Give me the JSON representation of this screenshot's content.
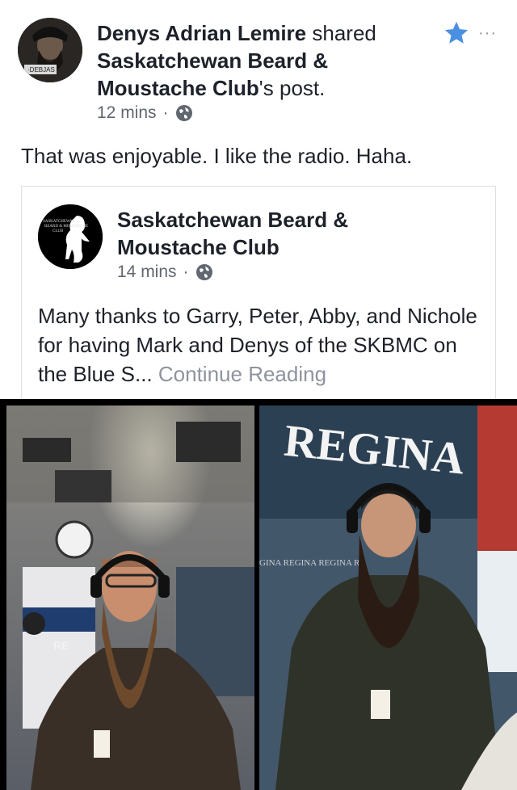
{
  "post": {
    "author": "Denys Adrian Lemire",
    "action": "shared",
    "shared_page": "Saskatchewan Beard & Moustache Club",
    "shared_suffix": "'s post.",
    "time": "12 mins",
    "separator": "·",
    "text": "That was enjoyable. I like the radio. Haha.",
    "more_label": "···"
  },
  "shared_post": {
    "page_name_line1": "Saskatchewan Beard &",
    "page_name_line2": "Moustache Club",
    "time": "14 mins",
    "separator": "·",
    "text": "Many thanks to Garry, Peter, Abby, and Nichole for having Mark and Denys of the SKBMC on the Blue S...",
    "continue_label": "Continue Reading"
  },
  "photos": {
    "left_sign": "RE",
    "right_sign": "REGINA",
    "right_wall_text": "GINA REGINA REGINA RE"
  },
  "colors": {
    "accent": "#4267b2",
    "meta": "#606770",
    "muted": "#8d949e"
  }
}
